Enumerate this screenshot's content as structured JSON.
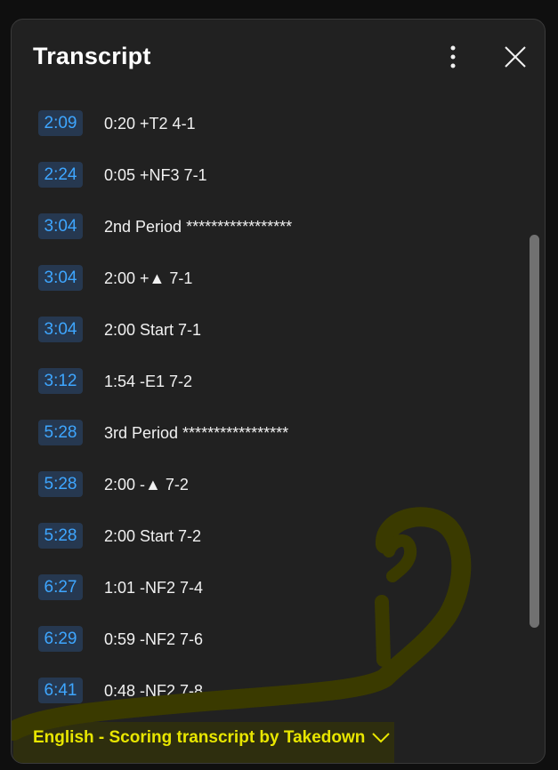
{
  "header": {
    "title": "Transcript",
    "more_icon": "more-vertical-icon",
    "close_icon": "close-icon"
  },
  "segments": [
    {
      "time": "2:09",
      "text": "0:20 +T2 4-1"
    },
    {
      "time": "2:24",
      "text": "0:05 +NF3 7-1"
    },
    {
      "time": "3:04",
      "text": "2nd Period *****************"
    },
    {
      "time": "3:04",
      "text": "2:00 +▲ 7-1"
    },
    {
      "time": "3:04",
      "text": "2:00 Start 7-1"
    },
    {
      "time": "3:12",
      "text": "1:54 -E1 7-2"
    },
    {
      "time": "5:28",
      "text": "3rd Period *****************"
    },
    {
      "time": "5:28",
      "text": "2:00 -▲ 7-2"
    },
    {
      "time": "5:28",
      "text": "2:00 Start 7-2"
    },
    {
      "time": "6:27",
      "text": "1:01 -NF2 7-4"
    },
    {
      "time": "6:29",
      "text": "0:59 -NF2 7-6"
    },
    {
      "time": "6:41",
      "text": "0:48 -NF2 7-8"
    }
  ],
  "footer": {
    "language_label": "English - Scoring transcript by Takedown",
    "dropdown_icon": "chevron-down-icon"
  },
  "colors": {
    "timestamp_text": "#3ea6ff",
    "timestamp_bg": "#263850",
    "footer_text": "#e8e600",
    "scribble": "#3a3a00"
  }
}
